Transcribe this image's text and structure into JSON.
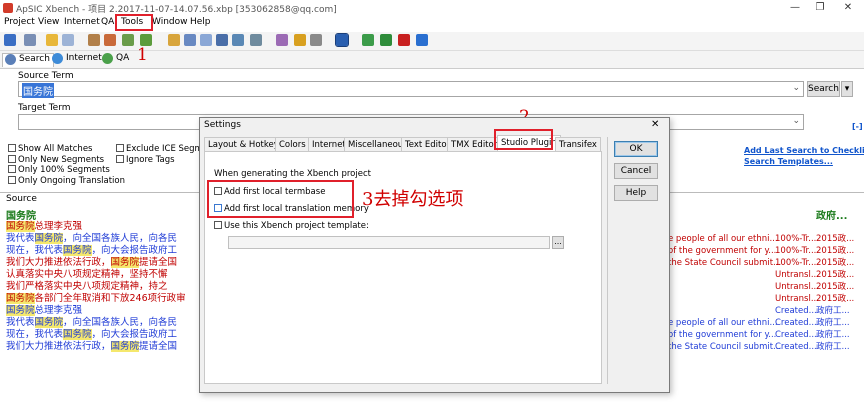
{
  "window": {
    "title": "ApSIC Xbench - 项目 2.2017-11-07-14.07.56.xbp [353062858@qq.com]",
    "controls": [
      "—",
      "❐",
      "✕"
    ]
  },
  "menu": [
    "Project",
    "View",
    "Internet",
    "QA",
    "Tools",
    "Window",
    "Help"
  ],
  "annotations": {
    "a1": "1",
    "a2": "2",
    "a3": "3去掉勾选项"
  },
  "search_tabs": [
    "Search",
    "Internet",
    "QA"
  ],
  "source_term": {
    "label": "Source Term",
    "value": "国务院"
  },
  "target_term": {
    "label": "Target Term",
    "value": ""
  },
  "search_button": "Search",
  "options": [
    "Show All Matches",
    "Only New Segments",
    "Only 100% Segments",
    "Only Ongoing Translation",
    "Exclude ICE Segmen",
    "Ignore Tags"
  ],
  "links": {
    "add_last_search": "Add Last Search to Checklist...",
    "search_templates": "Search Templates...",
    "collapse": "[-]"
  },
  "results": {
    "header": "Source",
    "group": "国务院",
    "rows": [
      {
        "color": "red",
        "pre": "",
        "hl": "国务院",
        "post": "总理李克强"
      },
      {
        "color": "blue",
        "pre": "我代表",
        "hl": "国务院",
        "post": "，向全国各族人民，向各民"
      },
      {
        "color": "blue",
        "pre": "现在，我代表",
        "hl": "国务院",
        "post": "，向大会报告政府工"
      },
      {
        "color": "red",
        "pre": "我们大力推进依法行政，",
        "hl": "国务院",
        "post": "提请全国"
      },
      {
        "color": "red",
        "pre": "认真落实中央八项规定精神，坚持不懈",
        "hl": "",
        "post": ""
      },
      {
        "color": "red",
        "pre": "我们严格落实中央八项规定精神，持之",
        "hl": "",
        "post": ""
      },
      {
        "color": "red",
        "pre": "",
        "hl": "国务院",
        "post": "各部门全年取消和下放246项行政审"
      },
      {
        "color": "blue",
        "pre": "",
        "hl": "国务院",
        "post": "总理李克强"
      },
      {
        "color": "blue",
        "pre": "我代表",
        "hl": "国务院",
        "post": "，向全国各族人民，向各民"
      },
      {
        "color": "blue",
        "pre": "现在，我代表",
        "hl": "国务院",
        "post": "，向大会报告政府工"
      },
      {
        "color": "blue",
        "pre": "我们大力推进依法行政，",
        "hl": "国务院",
        "post": "提请全国"
      }
    ],
    "target_rows": [
      {
        "color": "red",
        "text": ""
      },
      {
        "color": "red",
        "text": "e people of all our ethni..."
      },
      {
        "color": "red",
        "text": "of the government for y..."
      },
      {
        "color": "red",
        "text": "the State Council submit..."
      },
      {
        "color": "red",
        "text": ""
      },
      {
        "color": "red",
        "text": ""
      },
      {
        "color": "red",
        "text": ""
      },
      {
        "color": "blue",
        "text": ""
      },
      {
        "color": "blue",
        "text": "e people of all our ethni..."
      },
      {
        "color": "blue",
        "text": "of the government for y..."
      },
      {
        "color": "blue",
        "text": "the State Council submit..."
      }
    ],
    "right_group": "政府...",
    "status_rows": [
      {
        "color": "red",
        "status": "",
        "file": ""
      },
      {
        "color": "red",
        "status": "100%-Tr...",
        "file": "2015政..."
      },
      {
        "color": "red",
        "status": "100%-Tr...",
        "file": "2015政..."
      },
      {
        "color": "red",
        "status": "100%-Tr...",
        "file": "2015政..."
      },
      {
        "color": "red",
        "status": "Untransl...",
        "file": "2015政..."
      },
      {
        "color": "red",
        "status": "Untransl...",
        "file": "2015政..."
      },
      {
        "color": "red",
        "status": "Untransl...",
        "file": "2015政..."
      },
      {
        "color": "blue",
        "status": "Created...",
        "file": "政府工..."
      },
      {
        "color": "blue",
        "status": "Created...",
        "file": "政府工..."
      },
      {
        "color": "blue",
        "status": "Created...",
        "file": "政府工..."
      },
      {
        "color": "blue",
        "status": "Created...",
        "file": "政府工..."
      }
    ]
  },
  "dialog": {
    "title": "Settings",
    "close": "✕",
    "tabs": [
      "Layout & Hotkeys",
      "Colors",
      "Internet",
      "Miscellaneous",
      "Text Editor",
      "TMX Editor",
      "Studio Plugin",
      "Transifex"
    ],
    "section_label": "When generating the Xbench project",
    "checkboxes": [
      "Add first local termbase",
      "Add first local translation memory",
      "Use this Xbench project template:"
    ],
    "browse": "...",
    "buttons": {
      "ok": "OK",
      "cancel": "Cancel",
      "help": "Help"
    }
  }
}
